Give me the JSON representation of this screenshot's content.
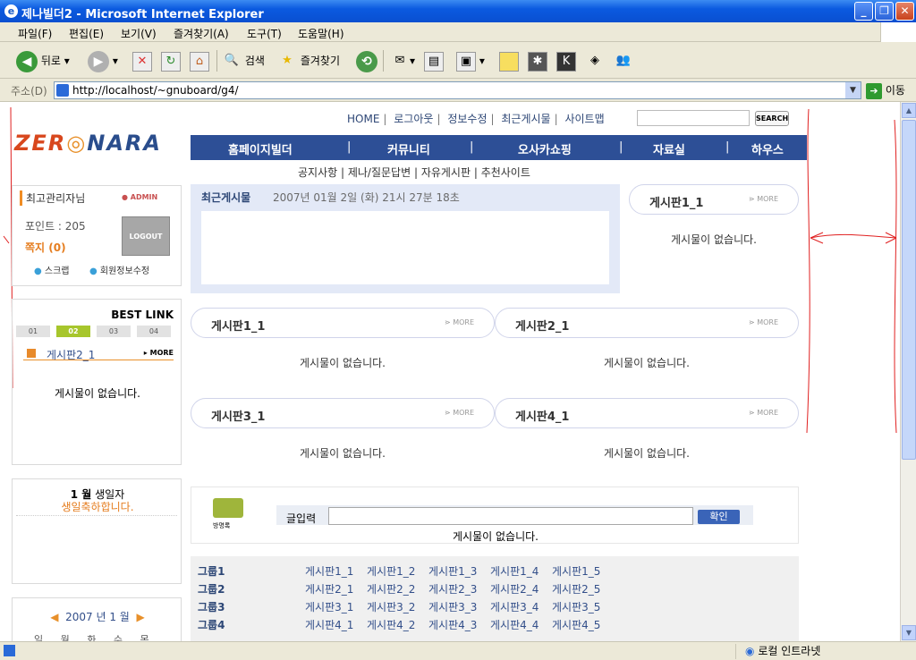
{
  "window": {
    "title": "제나빌더2 - Microsoft Internet Explorer"
  },
  "menus": [
    "파일(F)",
    "편집(E)",
    "보기(V)",
    "즐겨찾기(A)",
    "도구(T)",
    "도움말(H)"
  ],
  "toolbar": {
    "back": "뒤로",
    "search": "검색",
    "favorites": "즐겨찾기"
  },
  "address": {
    "label": "주소(D)",
    "url": "http://localhost/~gnuboard/g4/",
    "go": "이동"
  },
  "status": {
    "zone": "로컬 인트라넷"
  },
  "page": {
    "logo": {
      "a": "ZER",
      "b": "NARA"
    },
    "topnav": [
      "HOME",
      "로그아웃",
      "정보수정",
      "최근게시물",
      "사이트맵"
    ],
    "search_btn": "SEARCH",
    "mainnav": [
      "홈페이지빌더",
      "커뮤니티",
      "오사카쇼핑",
      "자료실",
      "하우스"
    ],
    "subnav": [
      "공지사항",
      "제나/질문답변",
      "자유게시판",
      "추천사이트"
    ],
    "user": {
      "name": "최고관리자님",
      "role": "ADMIN",
      "points": "포인트 : 205",
      "memo": "쪽지 (0)",
      "logout": "LOGOUT",
      "scrap": "스크랩",
      "member_edit": "회원정보수정"
    },
    "bestlink": {
      "title": "BEST LINK",
      "tabs": [
        "01",
        "02",
        "03",
        "04"
      ],
      "board": "게시판2_1",
      "more": "MORE",
      "empty": "게시물이 없습니다."
    },
    "birthday": {
      "line1a": "1 월",
      "line1b": " 생일자",
      "line2": "생일축하합니다."
    },
    "calendar": {
      "month": "2007 년 1 월",
      "days": "일 월 화 수 목 금 토"
    },
    "latest": {
      "title": "최근게시물",
      "date": "2007년 01월 2일 (화)  21시 27분 18초"
    },
    "boards": [
      {
        "name": "게시판1_1",
        "more": "MORE",
        "empty": "게시물이 없습니다."
      },
      {
        "name": "게시판1_1",
        "more": "MORE",
        "empty": "게시물이 없습니다."
      },
      {
        "name": "게시판2_1",
        "more": "MORE",
        "empty": "게시물이 없습니다."
      },
      {
        "name": "게시판3_1",
        "more": "MORE",
        "empty": "게시물이 없습니다."
      },
      {
        "name": "게시판4_1",
        "more": "MORE",
        "empty": "게시물이 없습니다."
      }
    ],
    "guestbook": {
      "icon_label": "방명록",
      "label": "글입력",
      "ok": "확인",
      "empty": "게시물이 없습니다."
    },
    "groups": [
      {
        "name": "그룹1",
        "boards": [
          "게시판1_1",
          "게시판1_2",
          "게시판1_3",
          "게시판1_4",
          "게시판1_5"
        ]
      },
      {
        "name": "그룹2",
        "boards": [
          "게시판2_1",
          "게시판2_2",
          "게시판2_3",
          "게시판2_4",
          "게시판2_5"
        ]
      },
      {
        "name": "그룹3",
        "boards": [
          "게시판3_1",
          "게시판3_2",
          "게시판3_3",
          "게시판3_4",
          "게시판3_5"
        ]
      },
      {
        "name": "그룹4",
        "boards": [
          "게시판4_1",
          "게시판4_2",
          "게시판4_3",
          "게시판4_4",
          "게시판4_5"
        ]
      }
    ]
  }
}
